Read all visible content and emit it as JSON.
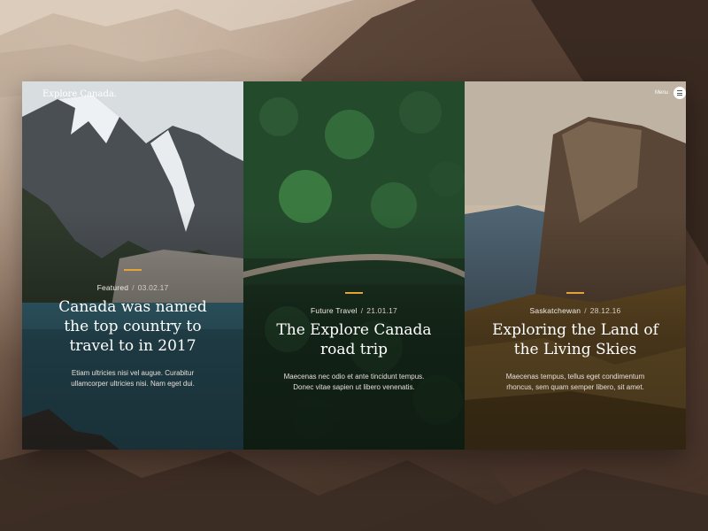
{
  "brand": "Explore Canada.",
  "menu": {
    "label": "Menu",
    "icon": "hamburger-icon"
  },
  "accent_color": "#e5a13a",
  "cards": [
    {
      "category": "Featured",
      "separator": "/",
      "date": "03.02.17",
      "title": "Canada was named the top country to travel to in 2017",
      "description": "Etiam ultricies nisi vel augue. Curabitur ullamcorper ultricies nisi. Nam eget dui."
    },
    {
      "category": "Future Travel",
      "separator": "/",
      "date": "21.01.17",
      "title": "The Explore Canada road trip",
      "description": "Maecenas nec odio et ante tincidunt tempus. Donec vitae sapien ut libero venenatis."
    },
    {
      "category": "Saskatchewan",
      "separator": "/",
      "date": "28.12.16",
      "title": "Exploring the Land of the Living Skies",
      "description": "Maecenas tempus, tellus eget condimentum rhoncus, sem quam semper libero, sit amet."
    }
  ]
}
